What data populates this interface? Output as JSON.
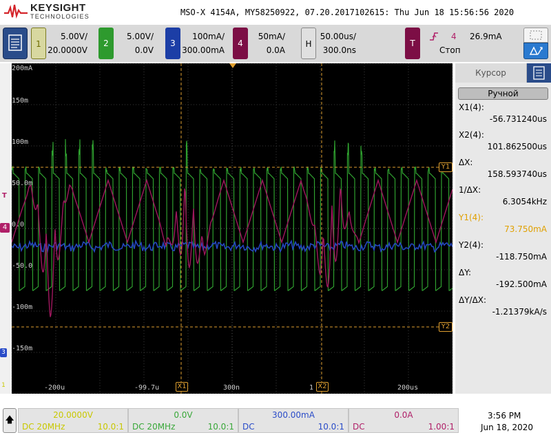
{
  "header": {
    "brand": "KEYSIGHT",
    "brand_sub": "TECHNOLOGIES",
    "title": "MSO-X 4154A, MY58250922, 07.20.2017102615: Thu Jun 18 15:56:56 2020"
  },
  "channels": [
    {
      "num": "1",
      "scale": "5.00V/",
      "offset": "20.0000V",
      "color": "#c8c800"
    },
    {
      "num": "2",
      "scale": "5.00V/",
      "offset": "0.0V",
      "color": "#39a839"
    },
    {
      "num": "3",
      "scale": "100mA/",
      "offset": "300.00mA",
      "color": "#2a4cc8"
    },
    {
      "num": "4",
      "scale": "50mA/",
      "offset": "0.0A",
      "color": "#b02068"
    }
  ],
  "horizontal": {
    "key": "H",
    "scale": "50.00us/",
    "delay": "300.0ns"
  },
  "trigger": {
    "key": "T",
    "edge_icon": "rising-edge",
    "source": "4",
    "level": "26.9mA",
    "mode": "Стоп"
  },
  "plot": {
    "y_labels": [
      "200mA",
      "150m",
      "100m",
      "50.0m",
      "0.0",
      "-50.0",
      "-100m",
      "-150m"
    ],
    "x_labels": [
      "-200u",
      "-99.7u",
      "300n",
      "1",
      "200us"
    ],
    "markers": {
      "x1": "X1",
      "x2": "X2",
      "y1": "Y1",
      "y2": "Y2",
      "t": "T",
      "ch4": "4",
      "ch3": "3",
      "ch1": "1"
    }
  },
  "cursor_panel": {
    "title": "Курсор",
    "mode": "Ручной",
    "rows": [
      {
        "label": "X1(4):",
        "value": "-56.731240us",
        "color": "#000000"
      },
      {
        "label": "X2(4):",
        "value": "101.862500us",
        "color": "#000000"
      },
      {
        "label": "ΔX:",
        "value": "158.593740us",
        "color": "#000000"
      },
      {
        "label": "1/ΔX:",
        "value": "6.3054kHz",
        "color": "#000000"
      },
      {
        "label": "Y1(4):",
        "value": "73.750mA",
        "color": "#e0a000"
      },
      {
        "label": "Y2(4):",
        "value": "-118.750mA",
        "color": "#000000"
      },
      {
        "label": "ΔY:",
        "value": "-192.500mA",
        "color": "#000000"
      },
      {
        "label": "ΔY/ΔX:",
        "value": "-1.21379kA/s",
        "color": "#000000"
      }
    ]
  },
  "bottom": {
    "cells": [
      {
        "top": "20.0000V",
        "coupling": "DC 20MHz",
        "probe": "10.0:1"
      },
      {
        "top": "0.0V",
        "coupling": "DC 20MHz",
        "probe": "10.0:1"
      },
      {
        "top": "300.00mA",
        "coupling": "DC",
        "probe": "10.0:1"
      },
      {
        "top": "0.0A",
        "coupling": "DC",
        "probe": "1.00:1"
      }
    ],
    "time": "3:56 PM",
    "date": "Jun 18, 2020"
  }
}
